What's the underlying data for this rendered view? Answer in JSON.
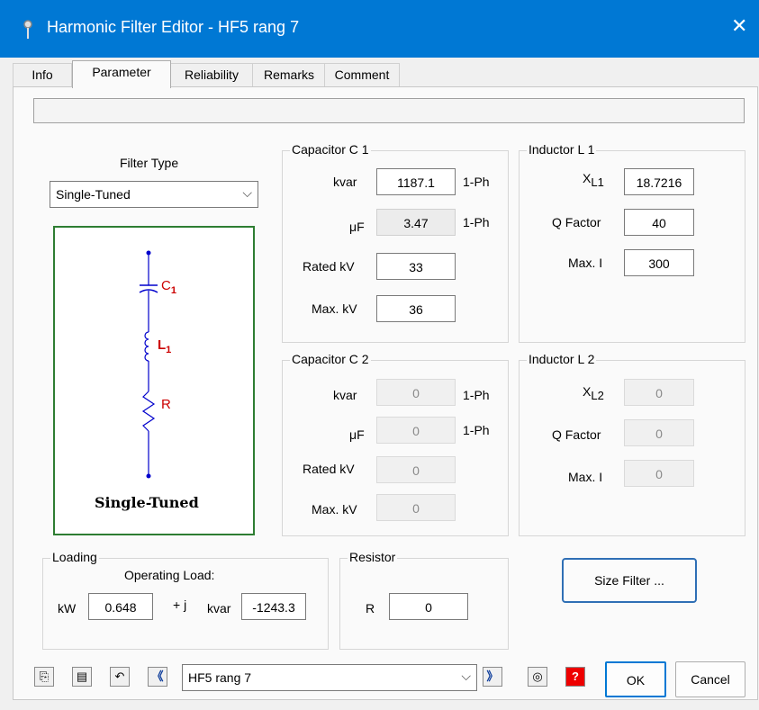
{
  "window": {
    "title": "Harmonic Filter Editor - HF5 rang 7",
    "close_glyph": "✕"
  },
  "tabs": [
    "Info",
    "Parameter",
    "Reliability",
    "Remarks",
    "Comment"
  ],
  "filter_type": {
    "label": "Filter Type",
    "selected": "Single-Tuned"
  },
  "diagram": {
    "c_label": "C",
    "c_sub": "1",
    "l_label": "L",
    "l_sub": "1",
    "r_label": "R",
    "caption": "Single-Tuned"
  },
  "capacitor_c1": {
    "title": "Capacitor C 1",
    "kvar_label": "kvar",
    "kvar": "1187.1",
    "kvar_unit": "1-Ph",
    "uf_label": "μF",
    "uf": "3.47",
    "uf_unit": "1-Ph",
    "rated_kv_label": "Rated kV",
    "rated_kv": "33",
    "max_kv_label": "Max. kV",
    "max_kv": "36"
  },
  "inductor_l1": {
    "title": "Inductor L 1",
    "xl_label": "X",
    "xl_sub": "L1",
    "xl": "18.7216",
    "q_label": "Q Factor",
    "q": "40",
    "maxi_label": "Max. I",
    "maxi": "300"
  },
  "capacitor_c2": {
    "title": "Capacitor C 2",
    "kvar_label": "kvar",
    "kvar": "0",
    "kvar_unit": "1-Ph",
    "uf_label": "μF",
    "uf": "0",
    "uf_unit": "1-Ph",
    "rated_kv_label": "Rated kV",
    "rated_kv": "0",
    "max_kv_label": "Max. kV",
    "max_kv": "0"
  },
  "inductor_l2": {
    "title": "Inductor L 2",
    "xl_label": "X",
    "xl_sub": "L2",
    "xl": "0",
    "q_label": "Q Factor",
    "q": "0",
    "maxi_label": "Max. I",
    "maxi": "0"
  },
  "loading": {
    "title": "Loading",
    "subtitle": "Operating Load:",
    "kw_label": "kW",
    "kw": "0.648",
    "j_label": "+ j",
    "kvar_label": "kvar",
    "kvar": "-1243.3"
  },
  "resistor": {
    "title": "Resistor",
    "r_label": "R",
    "r": "0"
  },
  "size_filter_label": "Size Filter ...",
  "bottom": {
    "selector": "HF5 rang 7",
    "ok_label": "OK",
    "cancel_label": "Cancel",
    "help_glyph": "?",
    "prev_glyph": "《",
    "next_glyph": "》"
  },
  "colors": {
    "titlebar": "#0078d4",
    "diagram_border": "#2e7d32",
    "wire": "#0000cc",
    "labels": "#cc0000"
  }
}
